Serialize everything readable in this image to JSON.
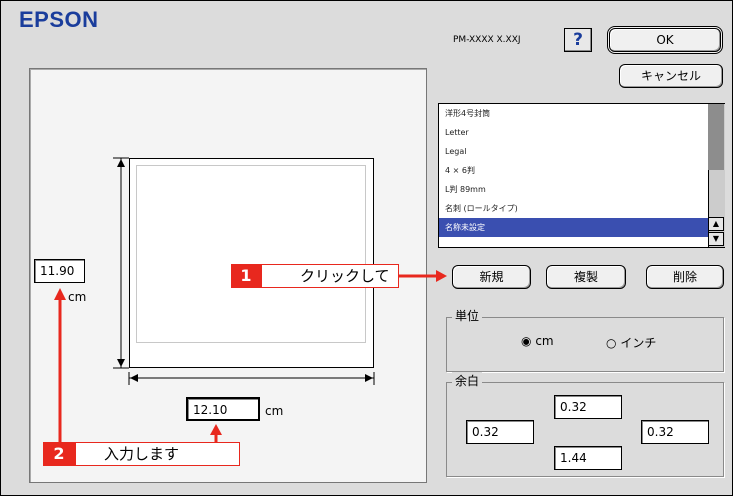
{
  "header": {
    "logo": "EPSON",
    "model": "PM-XXXX X.XXJ",
    "help": "?"
  },
  "buttons": {
    "ok": "OK",
    "cancel": "キャンセル",
    "new": "新規",
    "duplicate": "複製",
    "delete": "削除"
  },
  "paper_list": {
    "items": [
      "洋形4号封筒",
      "Letter",
      "Legal",
      "4 × 6判",
      "L判 89mm",
      "名刺 (ロールタイプ)",
      "名称未設定"
    ],
    "selected_index": 6
  },
  "dimensions": {
    "height_value": "11.90",
    "width_value": "12.10",
    "unit_label": "cm"
  },
  "units": {
    "legend": "単位",
    "options": [
      "cm",
      "インチ"
    ],
    "selected": "cm"
  },
  "margins": {
    "legend": "余白",
    "top": "0.32",
    "left": "0.32",
    "right": "0.32",
    "bottom": "1.44"
  },
  "callouts": [
    {
      "number": "1",
      "text": "クリックして"
    },
    {
      "number": "2",
      "text": "入力します"
    }
  ],
  "colors": {
    "accent_red": "#e8281e",
    "brand_blue": "#1a3d9c",
    "selection_blue": "#3a4fb0"
  }
}
